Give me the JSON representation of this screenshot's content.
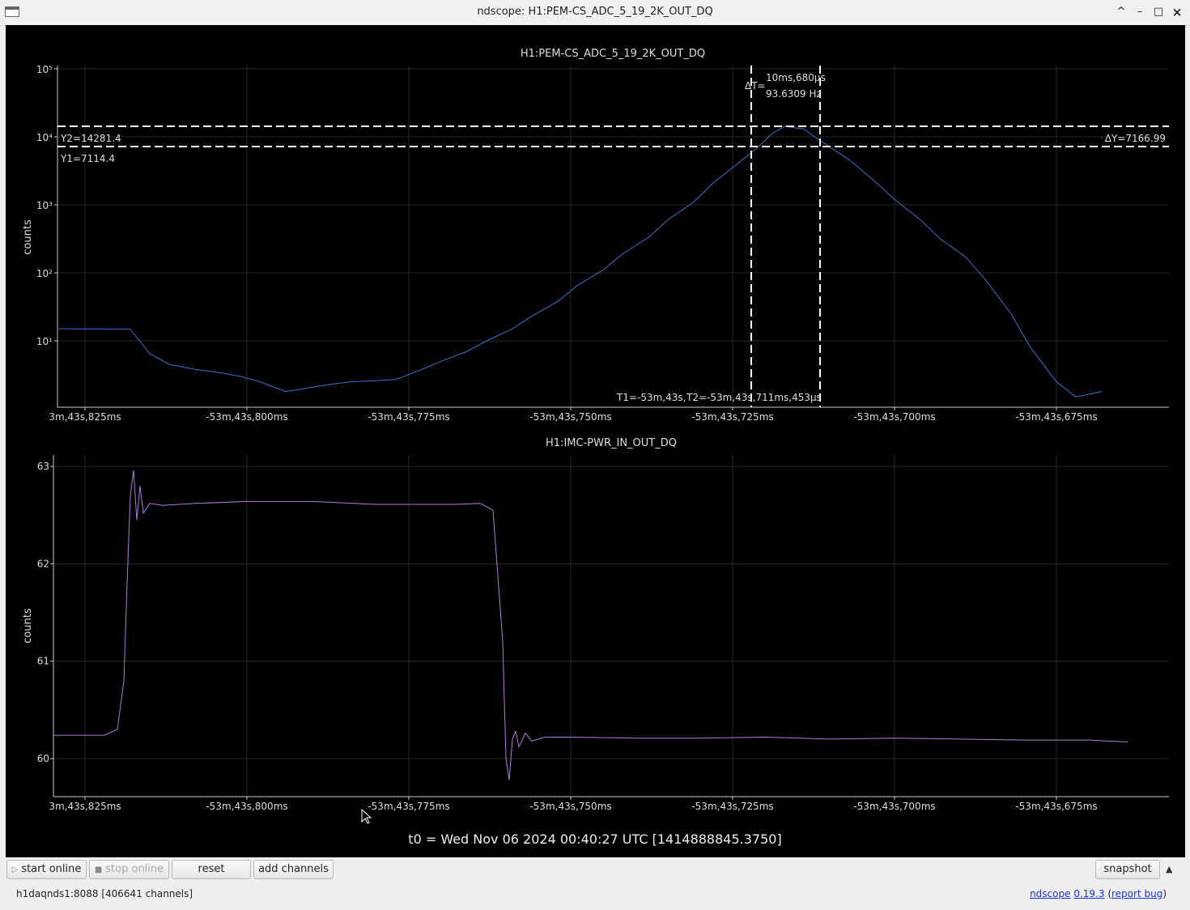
{
  "window": {
    "title": "ndscope: H1:PEM-CS_ADC_5_19_2K_OUT_DQ",
    "controls": [
      "^",
      "–",
      "□",
      "×"
    ]
  },
  "plots": [
    {
      "channel": "H1:PEM-CS_ADC_5_19_2K_OUT_DQ",
      "ylabel": "counts",
      "color": "#3d6fd1",
      "ytick_labels": [
        "10⁵",
        "10⁴",
        "10³",
        "10²",
        "10¹"
      ]
    },
    {
      "channel": "H1:IMC-PWR_IN_OUT_DQ",
      "ylabel": "counts",
      "color": "#b27be0",
      "ytick_labels": [
        "63",
        "62",
        "61",
        "60"
      ]
    }
  ],
  "xtick_labels": [
    "3m,43s,825ms",
    "-53m,43s,800ms",
    "-53m,43s,775ms",
    "-53m,43s,750ms",
    "-53m,43s,725ms",
    "-53m,43s,700ms",
    "-53m,43s,675ms"
  ],
  "cursors": {
    "y2_label": "Y2=14281.4",
    "y1_label": "Y1=7114.4",
    "dy_label": "ΔY=7166.99",
    "dt_prefix": "ΔT=",
    "dt_value": "10ms,680µs",
    "dt_freq": "93.6309 Hz",
    "t1_label": "T1=-53m,43s,",
    "t2_label": "T2=-53m,43s,711ms,453µs"
  },
  "t0": "t0 = Wed Nov 06 2024 00:40:27 UTC [1414888845.3750]",
  "buttons": {
    "start_online": "start online",
    "stop_online": "stop online",
    "reset": "reset",
    "add_channels": "add channels",
    "snapshot": "snapshot"
  },
  "status": {
    "server": "h1daqnds1:8088  [406641 channels]",
    "app_name": "ndscope",
    "version": "0.19.3",
    "report_bug": "report bug"
  },
  "chart_data": [
    {
      "type": "line",
      "title": "H1:PEM-CS_ADC_5_19_2K_OUT_DQ",
      "ylabel": "counts",
      "yscale": "log",
      "ylim": [
        1.5,
        100000
      ],
      "x_unit": "ms relative to t0 offset -53m,43s",
      "x": [
        -836,
        -833,
        -829,
        -826,
        -822,
        -818,
        -815,
        -812,
        -808,
        -805,
        -801,
        -798,
        -794,
        -791,
        -787,
        -784,
        -780,
        -777,
        -773,
        -770,
        -766,
        -763,
        -759,
        -756,
        -752,
        -749,
        -745,
        -742,
        -738,
        -735,
        -731,
        -728,
        -724,
        -721,
        -719,
        -717,
        -714,
        -712,
        -710,
        -707,
        -703,
        -700,
        -696,
        -693,
        -689,
        -686,
        -682,
        -679,
        -675,
        -672,
        -668
      ],
      "y": [
        15.5,
        15.2,
        15.1,
        15.0,
        15.0,
        14.8,
        6.5,
        4.5,
        3.8,
        3.5,
        3.0,
        2.5,
        1.8,
        2.0,
        2.3,
        2.5,
        2.6,
        2.7,
        3.8,
        5.0,
        7.0,
        10.0,
        15.0,
        23.0,
        38.0,
        65.0,
        110.0,
        190.0,
        330.0,
        600.0,
        1100.0,
        2100.0,
        4200.0,
        7114.4,
        11000.0,
        14281.4,
        13000.0,
        9500.0,
        7114.4,
        4600.0,
        2200.0,
        1200.0,
        600.0,
        320.0,
        170.0,
        80.0,
        25.0,
        8.0,
        2.5,
        1.5,
        1.8
      ],
      "cursors": {
        "Y1": 7114.4,
        "Y2": 14281.4,
        "dY": 7166.99,
        "dT_ms": 10.68,
        "freq_Hz": 93.6309
      }
    },
    {
      "type": "line",
      "title": "H1:IMC-PWR_IN_OUT_DQ",
      "ylabel": "counts",
      "ylim": [
        59.6,
        63.1
      ],
      "x_unit": "ms relative to t0 offset -53m,43s",
      "x": [
        -836,
        -829,
        -822,
        -820,
        -819,
        -818.5,
        -818,
        -817.5,
        -817,
        -816.5,
        -816,
        -815,
        -813,
        -808,
        -800,
        -790,
        -780,
        -776,
        -772,
        -768,
        -764,
        -762,
        -760.5,
        -760,
        -759.5,
        -759,
        -758.5,
        -758,
        -757,
        -756,
        -754,
        -750,
        -740,
        -730,
        -720,
        -710,
        -700,
        -690,
        -680,
        -670,
        -664
      ],
      "y": [
        60.24,
        60.24,
        60.24,
        60.3,
        60.8,
        61.8,
        62.7,
        62.96,
        62.45,
        62.8,
        62.52,
        62.62,
        62.6,
        62.62,
        62.64,
        62.64,
        62.61,
        62.61,
        62.61,
        62.61,
        62.62,
        62.55,
        61.2,
        60.0,
        59.78,
        60.2,
        60.28,
        60.12,
        60.26,
        60.18,
        60.22,
        60.22,
        60.21,
        60.21,
        60.22,
        60.2,
        60.21,
        60.2,
        60.19,
        60.19,
        60.17
      ]
    }
  ]
}
